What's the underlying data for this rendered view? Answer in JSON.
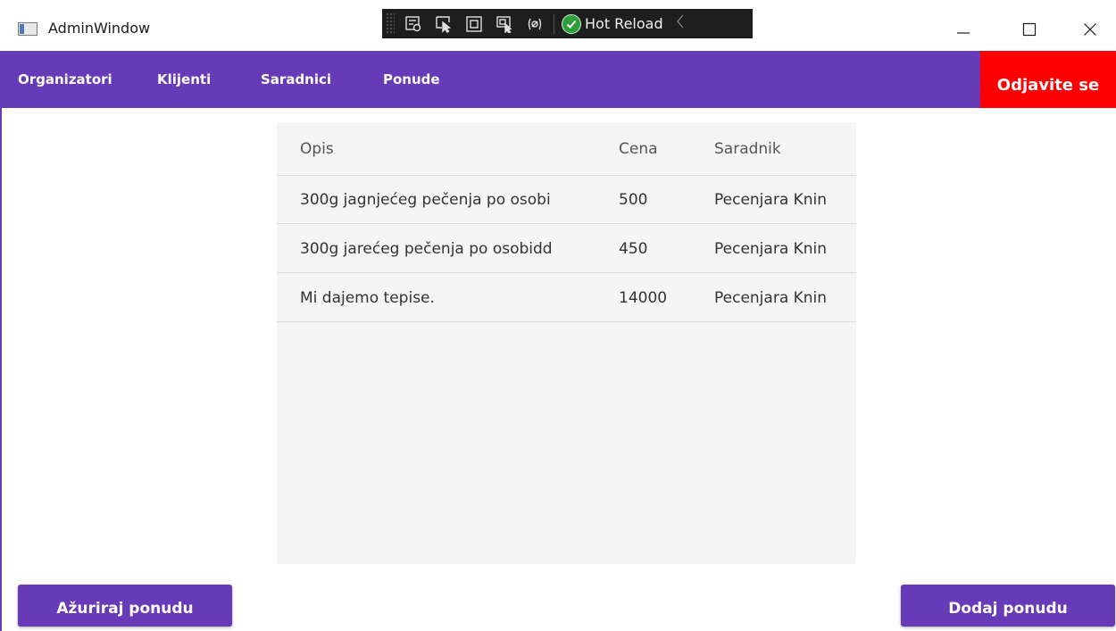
{
  "window": {
    "title": "AdminWindow",
    "devtools": {
      "hot_reload_label": "Hot Reload"
    }
  },
  "nav": {
    "items": [
      {
        "label": "Organizatori"
      },
      {
        "label": "Klijenti"
      },
      {
        "label": "Saradnici"
      },
      {
        "label": "Ponude"
      }
    ],
    "logout_label": "Odjavite se"
  },
  "grid": {
    "columns": [
      "Opis",
      "Cena",
      "Saradnik"
    ],
    "rows": [
      {
        "opis": "300g jagnjećeg pečenja po osobi",
        "cena": "500",
        "saradnik": "Pecenjara Knin"
      },
      {
        "opis": "300g jarećeg pečenja po osobidd",
        "cena": "450",
        "saradnik": "Pecenjara Knin"
      },
      {
        "opis": "Mi dajemo tepise.",
        "cena": "14000",
        "saradnik": "Pecenjara Knin"
      }
    ]
  },
  "actions": {
    "update_label": "Ažuriraj ponudu",
    "add_label": "Dodaj ponudu"
  },
  "colors": {
    "primary": "#673ab7",
    "logout": "#ff0000",
    "grid_background": "#f5f5f5"
  }
}
